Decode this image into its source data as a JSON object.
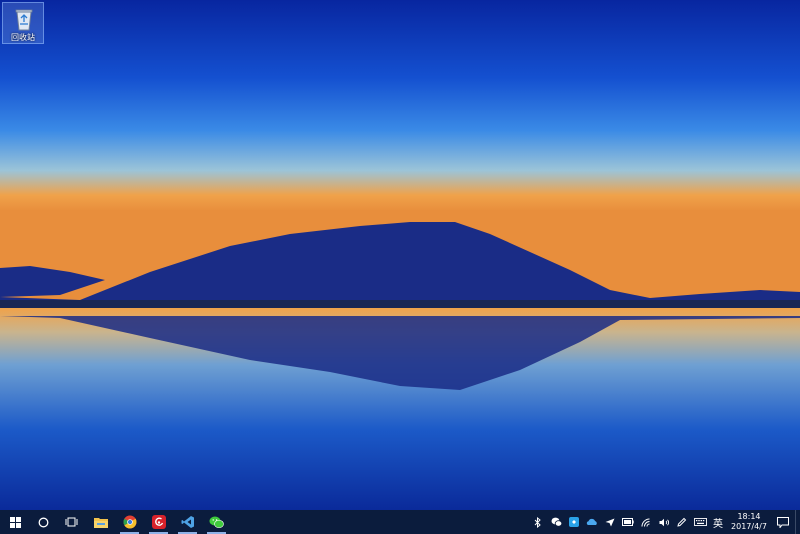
{
  "desktop": {
    "icons": [
      {
        "label": "回收站",
        "icon": "recycle-bin-icon"
      }
    ]
  },
  "taskbar": {
    "start_icon": "windows-logo-icon",
    "search_icon": "cortana-circle-icon",
    "task_view_icon": "task-view-icon",
    "pinned_apps": [
      {
        "icon": "file-explorer-icon"
      },
      {
        "icon": "chrome-icon"
      },
      {
        "icon": "netease-music-icon"
      },
      {
        "icon": "visual-studio-icon"
      },
      {
        "icon": "wechat-icon"
      }
    ],
    "tray_icons": [
      "bluetooth-icon",
      "wechat-tray-icon",
      "tray-app-icon",
      "onedrive-icon",
      "send-icon",
      "battery-icon",
      "wifi-icon",
      "volume-icon",
      "pen-icon",
      "keyboard-icon"
    ],
    "ime_label": "英",
    "clock": {
      "time": "18:14",
      "date": "2017/4/7"
    },
    "notification_icon": "action-center-icon"
  },
  "colors": {
    "taskbar_bg": "#0b1c3d",
    "sky_top": "#0a2a9a",
    "horizon_orange": "#f0a24a",
    "mountain": "#1a2c86"
  }
}
